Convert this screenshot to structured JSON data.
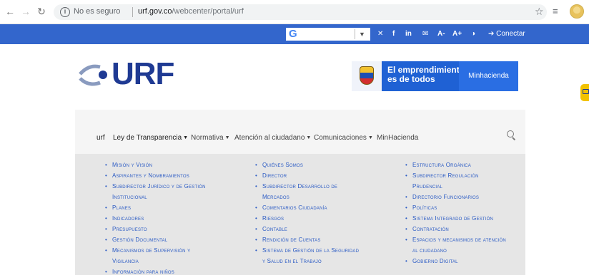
{
  "browser": {
    "security_label": "No es seguro",
    "url_domain": "urf.gov.co",
    "url_path": "/webcenter/portal/urf"
  },
  "topbar": {
    "translate_logo": "G",
    "social": [
      "✕",
      "f",
      "in",
      "✉",
      "A-",
      "A+",
      "◑"
    ],
    "login_label": "Conectar"
  },
  "header": {
    "logo_text": "URF",
    "banner_text_line1": "El emprendimiento",
    "banner_text_line2": "es de todos",
    "banner_right": "Minhacienda"
  },
  "nav": {
    "items": [
      {
        "label": "urf",
        "caret": false
      },
      {
        "label": "Ley de Transparencia",
        "caret": true
      },
      {
        "label": "Normativa",
        "caret": true
      },
      {
        "label": "Atención al ciudadano",
        "caret": true
      },
      {
        "label": "Comunicaciones",
        "caret": true
      },
      {
        "label": "MinHacienda",
        "caret": false
      }
    ]
  },
  "dropdown": {
    "col1": [
      "Misión y Visión",
      "Aspirantes y Nombramientos",
      "Subdirector Jurídico y de Gestión",
      "Institucional",
      "Planes",
      "Indicadores",
      "Presupuesto",
      "Gestión Documental",
      "Mecanismos de Supervisión y",
      "Vigilancia",
      "Información para niños"
    ],
    "col2": [
      "Quiénes Somos",
      "Director",
      "Subdirector Desarrollo de",
      "Mercados",
      "Comentarios Ciudadanía",
      "Riesgos",
      "Contable",
      "Rendición de Cuentas",
      "Sistema de Gestión de la Seguridad",
      "y Salud en el Trabajo"
    ],
    "col3": [
      "Estructura Orgánica",
      "Subdirector Regulación",
      "Prudencial",
      "Directorio Funcionarios",
      "Políticas",
      "Sistema Integrado de Gestión",
      "Contratación",
      "Espacios y mecanismos de atención",
      "al ciudadano",
      "Gobierno Digital"
    ]
  }
}
